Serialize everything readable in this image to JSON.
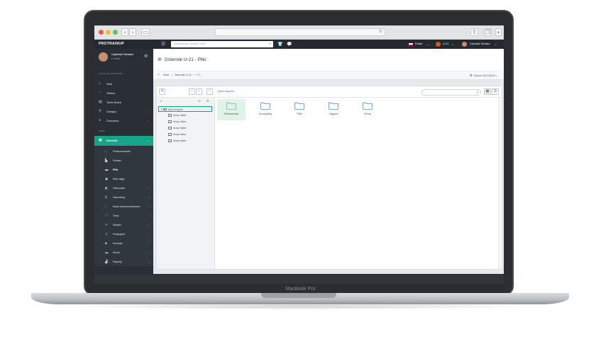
{
  "device": {
    "label": "MacBook Pro"
  },
  "browser": {
    "address": ""
  },
  "topbar": {
    "brand": "PROTRAINUP",
    "search_placeholder": "Szukaj osoby, zespołu i inne...",
    "language": "Polski",
    "team": "U-21",
    "user": "Cybulski Tomasz"
  },
  "sidebar": {
    "user": {
      "name": "Cybulski Tomasz",
      "role": "Trener"
    },
    "section_functions": "FUNKCJE OSOBISTE",
    "personal": [
      {
        "label": "Start",
        "icon": "home-icon"
      },
      {
        "label": "Tablica",
        "icon": "chat-icon"
      },
      {
        "label": "Tactic Board",
        "icon": "board-icon"
      },
      {
        "label": "Dostępy",
        "icon": "access-icon"
      },
      {
        "label": "Ćwiczenia",
        "icon": "exercise-icon"
      }
    ],
    "section_team": "MENU",
    "journal": {
      "label": "Dziennik"
    },
    "journal_items": [
      {
        "label": "Podsumowanie"
      },
      {
        "label": "Zestaw"
      },
      {
        "label": "Pliki"
      },
      {
        "label": "Plan zajęć"
      },
      {
        "label": "Obecności"
      },
      {
        "label": "Zawodnicy"
      },
      {
        "label": "Dane antropometryczne"
      },
      {
        "label": "Testy"
      },
      {
        "label": "Składki"
      },
      {
        "label": "Rozgrywki"
      },
      {
        "label": "Konsulje"
      },
      {
        "label": "Sezon"
      },
      {
        "label": "Raporty"
      }
    ]
  },
  "page": {
    "title": "Dziennik U-21 - Pliki",
    "breadcrumbs": [
      "Start",
      "Dziennik U-21",
      "Pliki"
    ],
    "breadcrumb_sep": "/",
    "season": "Sezon 2017/2018"
  },
  "filemanager": {
    "path_label": "Dysk zespołu",
    "tree_root": "Dysk zespołu",
    "tree_children": [
      "Nowy folder",
      "Nowy folder",
      "Nowy folder",
      "Nowy folder",
      "Nowy folder"
    ],
    "folders": [
      {
        "label": "Dokumenty",
        "selected": true
      },
      {
        "label": "Konspekty",
        "selected": false
      },
      {
        "label": "Pliki",
        "selected": false
      },
      {
        "label": "Zdjęcia",
        "selected": false
      },
      {
        "label": "Filmy",
        "selected": false
      }
    ]
  },
  "colors": {
    "accent": "#17a589",
    "sidebar": "#2a2f35",
    "topbar": "#24292f",
    "folder": "#5b8fbf"
  }
}
